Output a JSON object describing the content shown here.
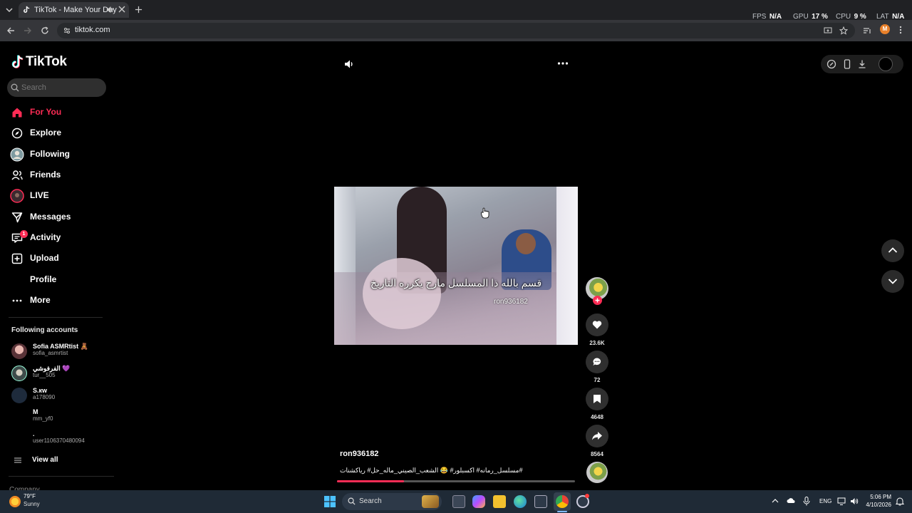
{
  "browser": {
    "tab_title": "TikTok - Make Your Day",
    "url": "tiktok.com",
    "stats": [
      {
        "label": "FPS",
        "value": "N/A"
      },
      {
        "label": "GPU",
        "value": "17 %"
      },
      {
        "label": "CPU",
        "value": "9 %"
      },
      {
        "label": "LAT",
        "value": "N/A"
      }
    ],
    "profile_initial": "M"
  },
  "sidebar": {
    "logo": "TikTok",
    "search_placeholder": "Search",
    "nav": [
      {
        "label": "For You",
        "icon": "home-icon",
        "active": true
      },
      {
        "label": "Explore",
        "icon": "compass-icon"
      },
      {
        "label": "Following",
        "icon": "following-avatar-icon"
      },
      {
        "label": "Friends",
        "icon": "friends-icon"
      },
      {
        "label": "LIVE",
        "icon": "live-icon"
      },
      {
        "label": "Messages",
        "icon": "messages-icon"
      },
      {
        "label": "Activity",
        "icon": "activity-icon",
        "badge": "1"
      },
      {
        "label": "Upload",
        "icon": "upload-icon"
      },
      {
        "label": "Profile",
        "icon": "profile-icon"
      },
      {
        "label": "More",
        "icon": "more-icon"
      }
    ],
    "following_title": "Following accounts",
    "accounts": [
      {
        "name": "Sofia ASMRtist 🧸",
        "username": "sofia_asmrtist"
      },
      {
        "name": "الفرفوشي 💜",
        "username": "tur__505"
      },
      {
        "name": "S.кw",
        "username": "a178090"
      },
      {
        "name": "M",
        "username": "mm_yf0"
      },
      {
        "name": ".",
        "username": "user1106370480094"
      }
    ],
    "view_all": "View all",
    "company": "Company"
  },
  "video": {
    "caption": "قسم بالله ذا المسلسل مارح يكرره التاريخ",
    "watermark": "ron936182",
    "author": "ron936182",
    "description": "مسلسل_رمانه# اكسبلور# 😂 الشعب_الصيني_ماله_حل# رياكشنات#",
    "progress": 0.28,
    "likes": "23.6K",
    "comments": "72",
    "saves": "4648",
    "shares": "8564"
  },
  "taskbar": {
    "temperature": "79°F",
    "weather": "Sunny",
    "search": "Search",
    "language": "ENG",
    "time": "5:06 PM",
    "date": "4/10/2026"
  },
  "colors": {
    "accent": "#fe2c55",
    "background": "#000000"
  }
}
